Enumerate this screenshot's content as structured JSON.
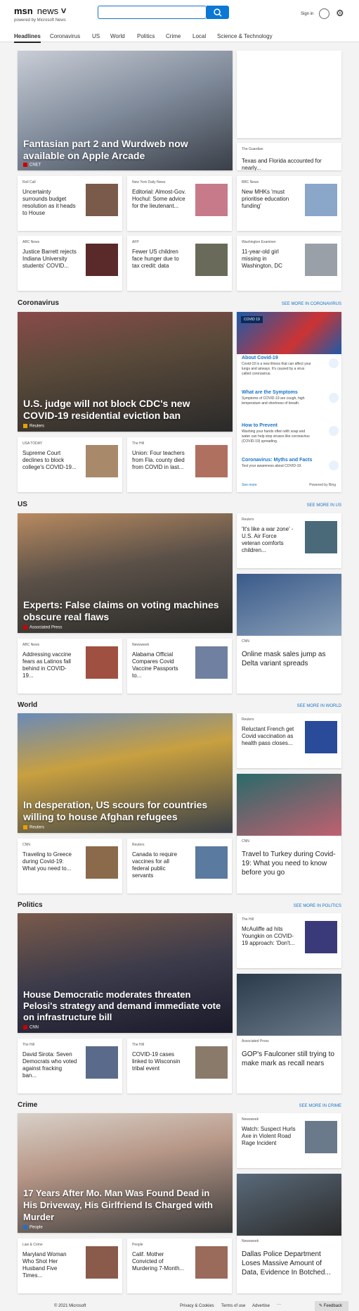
{
  "header": {
    "logo": "msn",
    "section": "news",
    "powered": "powered by Microsoft News",
    "signin": "Sign in"
  },
  "nav": [
    "Headlines",
    "Coronavirus",
    "US",
    "World",
    "Politics",
    "Crime",
    "Local",
    "Science & Technology"
  ],
  "top": {
    "hero": {
      "title": "Fantasian part 2 and Wurdweb now available on Apple Arcade",
      "source": "CNET"
    },
    "side": {
      "source": "The Guardian",
      "title": "Texas and Florida accounted for nearly..."
    },
    "cards": [
      {
        "source": "Roll Call",
        "title": "Uncertainty surrounds budget resolution as it heads to House"
      },
      {
        "source": "New York Daily News",
        "title": "Editorial: Almost-Gov. Hochul: Some advice for the lieutenant..."
      },
      {
        "source": "BBC News",
        "title": "New MHKs 'must prioritise education funding'"
      },
      {
        "source": "ABC News",
        "title": "Justice Barrett rejects Indiana University students' COVID..."
      },
      {
        "source": "AFP",
        "title": "Fewer US children face hunger due to tax credit: data"
      },
      {
        "source": "Washington Examiner",
        "title": "11-year-old girl missing in Washington, DC"
      }
    ]
  },
  "coronavirus": {
    "label": "Coronavirus",
    "more": "SEE MORE IN CORONAVIRUS",
    "hero": {
      "title": "U.S. judge will not block CDC's new COVID-19 residential eviction ban",
      "source": "Reuters"
    },
    "cards": [
      {
        "source": "USA TODAY",
        "title": "Supreme Court declines to block college's COVID-19..."
      },
      {
        "source": "The Hill",
        "title": "Union: Four teachers from Fla. county died from COVID in last..."
      }
    ],
    "panel": {
      "badge": "COVID 19",
      "items": [
        {
          "h": "About Covid-19",
          "d": "Covid-19 is a new illness that can affect your lungs and airways. It's caused by a virus called coronavirus."
        },
        {
          "h": "What are the Symptoms",
          "d": "Symptoms of COVID-19 are cough, high temperature and shortness of breath."
        },
        {
          "h": "How to Prevent",
          "d": "Washing your hands often with soap and water can help stop viruses like coronavirus (COVID-19) spreading."
        },
        {
          "h": "Coronavirus: Myths and Facts",
          "d": "Test your awareness about COVID-19."
        }
      ],
      "seemore": "See more",
      "powered": "Powered by Bing"
    }
  },
  "us": {
    "label": "US",
    "more": "SEE MORE IN US",
    "hero": {
      "title": "Experts: False claims on voting machines obscure real flaws",
      "source": "Associated Press"
    },
    "side": {
      "source": "Reuters",
      "title": "'It's like a war zone' - U.S. Air Force veteran comforts children..."
    },
    "big": {
      "source": "CNN",
      "title": "Online mask sales jump as Delta variant spreads"
    },
    "cards": [
      {
        "source": "ABC News",
        "title": "Addressing vaccine fears as Latinos fall behind in COVID-19..."
      },
      {
        "source": "Newsweek",
        "title": "Alabama Official Compares Covid Vaccine Passports to..."
      }
    ]
  },
  "world": {
    "label": "World",
    "more": "SEE MORE IN WORLD",
    "hero": {
      "title": "In desperation, US scours for countries willing to house Afghan refugees",
      "source": "Reuters"
    },
    "side": {
      "source": "Reuters",
      "title": "Reluctant French get Covid vaccination as health pass closes..."
    },
    "big": {
      "source": "CNN",
      "title": "Travel to Turkey during Covid-19: What you need to know before you go"
    },
    "cards": [
      {
        "source": "CNN",
        "title": "Traveling to Greece during Covid-19: What you need to..."
      },
      {
        "source": "Reuters",
        "title": "Canada to require vaccines for all federal public servants"
      }
    ]
  },
  "politics": {
    "label": "Politics",
    "more": "SEE MORE IN POLITICS",
    "hero": {
      "title": "House Democratic moderates threaten Pelosi's strategy and demand immediate vote on infrastructure bill",
      "source": "CNN"
    },
    "side": {
      "source": "The Hill",
      "title": "McAuliffe ad hits Youngkin on COVID-19 approach: 'Don't..."
    },
    "big": {
      "source": "Associated Press",
      "title": "GOP's Faulconer still trying to make mark as recall nears"
    },
    "cards": [
      {
        "source": "The Hill",
        "title": "David Sirota: Seven Democrats who voted against fracking ban..."
      },
      {
        "source": "The Hill",
        "title": "COVID-19 cases linked to Wisconsin tribal event"
      }
    ]
  },
  "crime": {
    "label": "Crime",
    "more": "SEE MORE IN CRIME",
    "hero": {
      "title": "17 Years After Mo. Man Was Found Dead in His Driveway, His Girlfriend Is Charged with Murder",
      "source": "People"
    },
    "side": {
      "source": "Newsweek",
      "title": "Watch: Suspect Hurls Axe in Violent Road Rage Incident"
    },
    "big": {
      "source": "Newsweek",
      "title": "Dallas Police Department Loses Massive Amount of Data, Evidence In Botched..."
    },
    "cards": [
      {
        "source": "Law & Crime",
        "title": "Maryland Woman Who Shot Her Husband Five Times..."
      },
      {
        "source": "People",
        "title": "Calif. Mother Convicted of Murdering 7-Month..."
      }
    ]
  },
  "footer": {
    "copy": "© 2021 Microsoft",
    "privacy": "Privacy & Cookies",
    "terms": "Terms of use",
    "advertise": "Advertise",
    "feedback": "Feedback"
  }
}
